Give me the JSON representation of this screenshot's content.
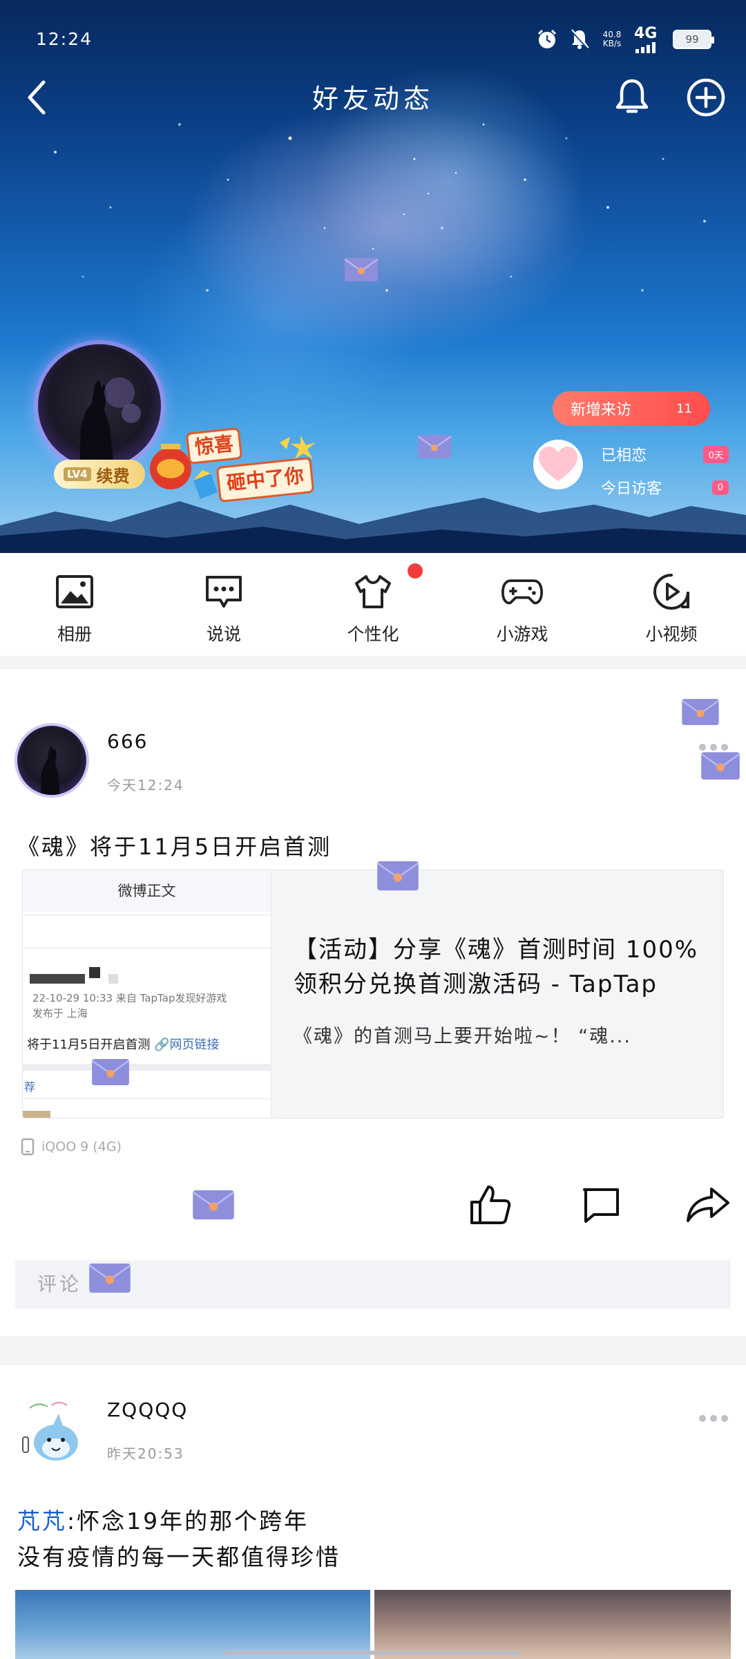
{
  "status_bar": {
    "time": "12:24",
    "net_speed_value": "40.8",
    "net_speed_unit": "KB/s",
    "network": "4G",
    "battery": "99"
  },
  "header": {
    "title": "好友动态",
    "vip_level": "LV4",
    "vip_renew": "续费",
    "sticker_text_1": "惊喜",
    "sticker_text_2": "砸中了你",
    "new_visits_label": "新增来访",
    "new_visits_count": "11",
    "stat_love_label": "已相恋",
    "stat_love_value": "0天",
    "stat_today_label": "今日访客",
    "stat_today_value": "0"
  },
  "quick_menu": {
    "items": [
      {
        "label": "相册",
        "icon": "photo-album-icon"
      },
      {
        "label": "说说",
        "icon": "chat-bubble-icon"
      },
      {
        "label": "个性化",
        "icon": "tshirt-icon"
      },
      {
        "label": "小游戏",
        "icon": "gamepad-icon"
      },
      {
        "label": "小视频",
        "icon": "video-play-icon"
      }
    ]
  },
  "posts": [
    {
      "author": "666",
      "time": "今天12:24",
      "text": "《魂》将于11月5日开启首测",
      "link": {
        "thumb_header": "微博正文",
        "thumb_meta_1": "22-10-29 10:33  来自 TapTap发现好游戏",
        "thumb_meta_2": "发布于 上海",
        "thumb_body": "将于11月5日开启首测",
        "thumb_link": "🔗网页链接",
        "thumb_footer": "荐",
        "title": "【活动】分享《魂》首测时间 100%领积分兑换首测激活码 - TapTap",
        "desc": "《魂》的首测马上要开始啦~！ “魂..."
      },
      "device": "iQOO 9 (4G)",
      "comment_placeholder": "评论"
    },
    {
      "author": "ZQQQQ",
      "time": "昨天20:53",
      "text_name": "芃芃",
      "text_line_1": ":怀念19年的那个跨年",
      "text_line_2": "没有疫情的每一天都值得珍惜"
    }
  ],
  "colors": {
    "accent_red": "#f33d3d",
    "visit_pill": "#ff5b5b",
    "link_blue": "#1a5fd0",
    "envelope": "#8d8fdc"
  }
}
